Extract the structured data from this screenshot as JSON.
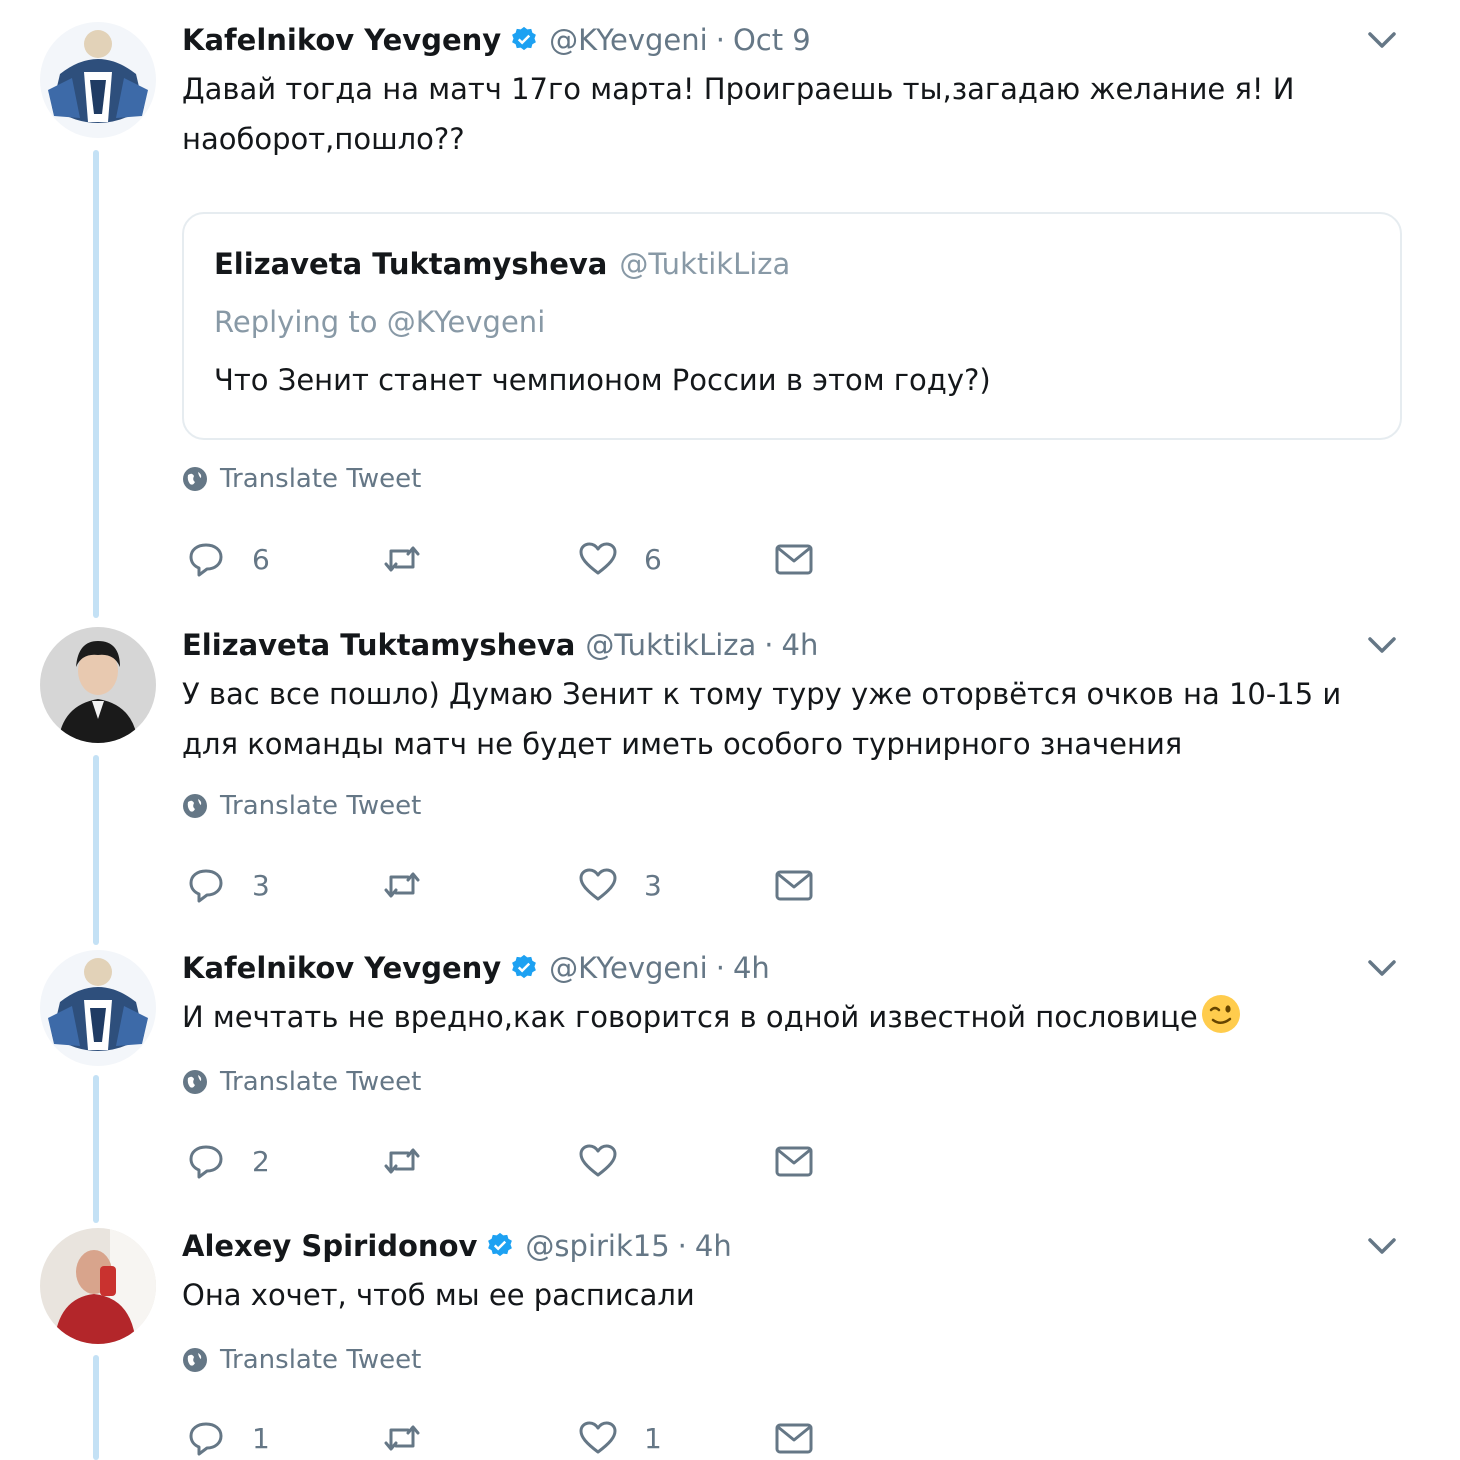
{
  "tweets": [
    {
      "author": "Kafelnikov Yevgeny",
      "handle": "@KYevgeni",
      "separator": "·",
      "time": "Oct 9",
      "text": "Давай тогда на матч 17го марта! Проиграешь ты,загадаю желание я! И наоборот,пошло??",
      "translate": "Translate Tweet",
      "replies": "6",
      "retweets": "",
      "likes": "6",
      "quote": {
        "author": "Elizaveta Tuktamysheva",
        "handle": "@TuktikLiza",
        "replying": "Replying to @KYevgeni",
        "text": "Что Зенит станет чемпионом России в этом году?)"
      }
    },
    {
      "author": "Elizaveta Tuktamysheva",
      "handle": "@TuktikLiza",
      "separator": "·",
      "time": "4h",
      "text": "У вас все пошло) Думаю Зенит к тому туру уже оторвётся очков на 10-15 и для команды матч не будет иметь особого турнирного значения",
      "translate": "Translate Tweet",
      "replies": "3",
      "retweets": "",
      "likes": "3"
    },
    {
      "author": "Kafelnikov Yevgeny",
      "handle": "@KYevgeni",
      "separator": "·",
      "time": "4h",
      "text": "И мечтать не вредно,как говорится в одной известной пословице",
      "translate": "Translate Tweet",
      "replies": "2",
      "retweets": "",
      "likes": ""
    },
    {
      "author": "Alexey Spiridonov",
      "handle": "@spirik15",
      "separator": "·",
      "time": "4h",
      "text": "Она хочет, чтоб мы ее расписали",
      "translate": "Translate Tweet",
      "replies": "1",
      "retweets": "",
      "likes": "1"
    }
  ],
  "icons": {
    "verified": "verified-badge-icon",
    "caret": "chevron-down-icon",
    "globe": "globe-icon",
    "reply": "reply-icon",
    "retweet": "retweet-icon",
    "like": "heart-icon",
    "dm": "envelope-icon",
    "emoji": "winking-face-emoji"
  },
  "colors": {
    "verified": "#1da1f2",
    "thread_line": "#c4e1f5",
    "secondary_text": "#657786",
    "border": "#e6ecf0"
  }
}
